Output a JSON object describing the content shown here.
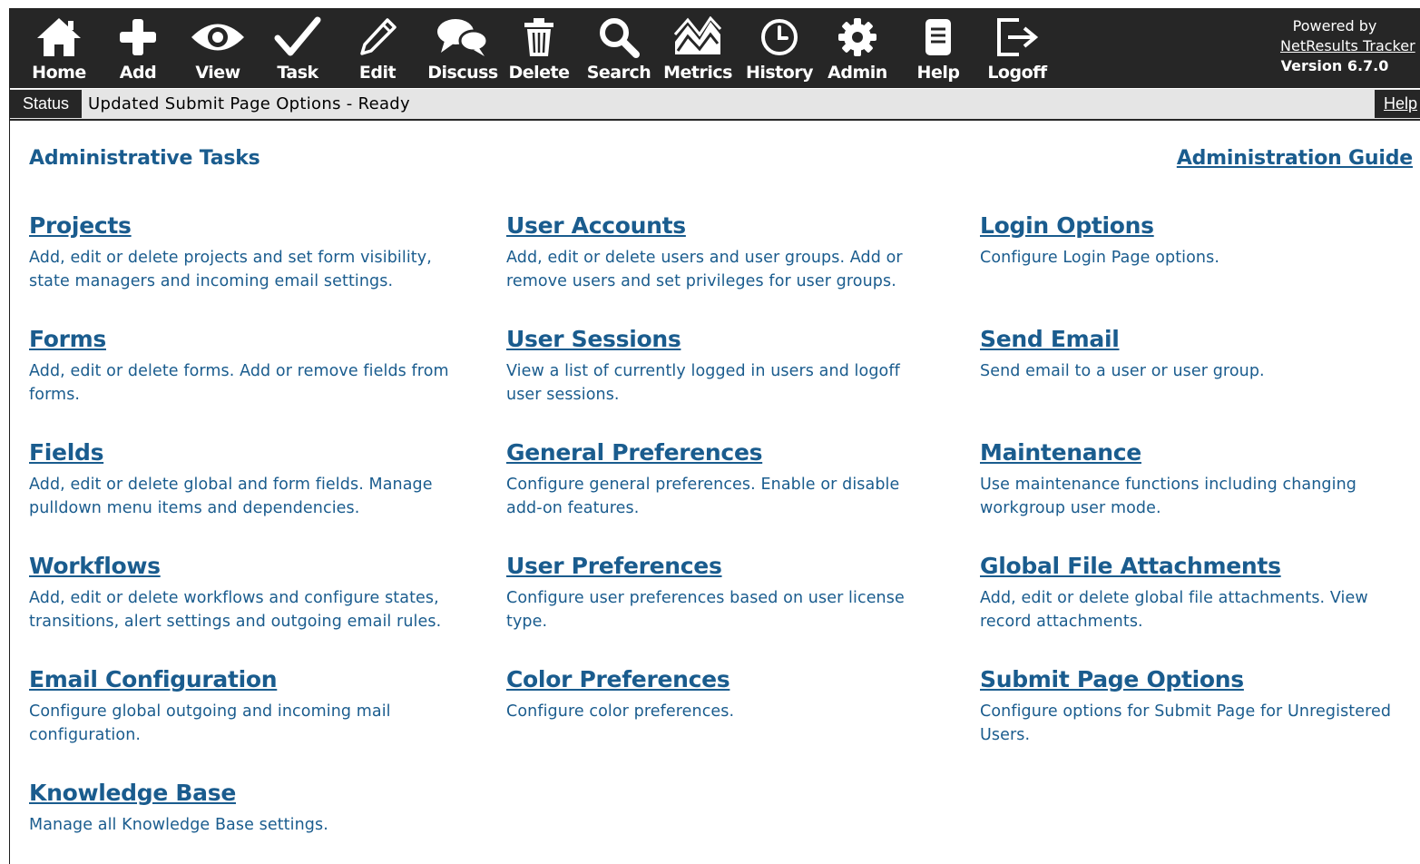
{
  "toolbar": {
    "items": [
      {
        "label": "Home",
        "icon": "home-icon"
      },
      {
        "label": "Add",
        "icon": "plus-icon"
      },
      {
        "label": "View",
        "icon": "eye-icon"
      },
      {
        "label": "Task",
        "icon": "checkmark-icon"
      },
      {
        "label": "Edit",
        "icon": "pencil-icon"
      },
      {
        "label": "Discuss",
        "icon": "speech-bubbles-icon"
      },
      {
        "label": "Delete",
        "icon": "trash-icon"
      },
      {
        "label": "Search",
        "icon": "magnifier-icon"
      },
      {
        "label": "Metrics",
        "icon": "chart-icon"
      },
      {
        "label": "History",
        "icon": "clock-icon"
      },
      {
        "label": "Admin",
        "icon": "gear-icon"
      },
      {
        "label": "Help",
        "icon": "document-icon"
      },
      {
        "label": "Logoff",
        "icon": "exit-icon"
      }
    ],
    "powered_by": "Powered by",
    "product_link": "NetResults Tracker",
    "version": "Version 6.7.0"
  },
  "status": {
    "tag": "Status",
    "message": "Updated Submit Page Options - Ready",
    "help": "Help"
  },
  "content": {
    "section_title": "Administrative Tasks",
    "guide_link": "Administration Guide",
    "tasks": [
      {
        "title": "Projects",
        "desc": "Add, edit or delete projects and set form visibility, state managers and incoming email settings."
      },
      {
        "title": "Forms",
        "desc": "Add, edit or delete forms. Add or remove fields from forms."
      },
      {
        "title": "Fields",
        "desc": "Add, edit or delete global and form fields. Manage pulldown menu items and dependencies."
      },
      {
        "title": "Workflows",
        "desc": "Add, edit or delete workflows and configure states, transitions, alert settings and outgoing email rules."
      },
      {
        "title": "Email Configuration",
        "desc": "Configure global outgoing and incoming mail configuration."
      },
      {
        "title": "Knowledge Base",
        "desc": "Manage all Knowledge Base settings."
      },
      {
        "title": "User Accounts",
        "desc": "Add, edit or delete users and user groups. Add or remove users and set privileges for user groups."
      },
      {
        "title": "User Sessions",
        "desc": "View a list of currently logged in users and logoff user sessions."
      },
      {
        "title": "General Preferences",
        "desc": "Configure general preferences. Enable or disable add-on features."
      },
      {
        "title": "User Preferences",
        "desc": "Configure user preferences based on user license type."
      },
      {
        "title": "Color Preferences",
        "desc": "Configure color preferences."
      },
      {
        "title": "Login Options",
        "desc": "Configure Login Page options."
      },
      {
        "title": "Send Email",
        "desc": "Send email to a user or user group."
      },
      {
        "title": "Maintenance",
        "desc": "Use maintenance functions including changing workgroup user mode."
      },
      {
        "title": "Global File Attachments",
        "desc": "Add, edit or delete global file attachments. View record attachments."
      },
      {
        "title": "Submit Page Options",
        "desc": "Configure options for Submit Page for Unregistered Users."
      }
    ]
  }
}
